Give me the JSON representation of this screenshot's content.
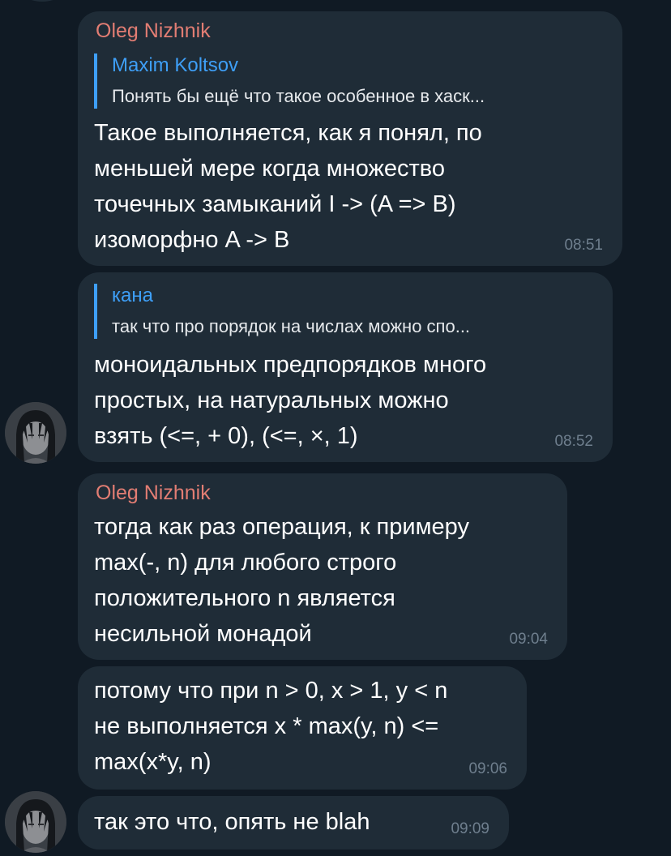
{
  "messages": [
    {
      "author": "Oleg Nizhnik",
      "reply": {
        "name": "Maxim Koltsov",
        "text": "Понять бы ещё что такое особенное в хаск..."
      },
      "text": "Такое выполняется, как я понял, по\nменьшей мере когда множество\nточечных замыканий I -> (A => B)\nизоморфно A -> B",
      "time": "08:51"
    },
    {
      "reply": {
        "name": "кана",
        "text": "так что про порядок на числах можно спо..."
      },
      "text": "моноидальных предпорядков много\nпростых, на натуральных можно\nвзять (<=, + 0), (<=, ×, 1)",
      "time": "08:52"
    },
    {
      "author": "Oleg Nizhnik",
      "text": "тогда как раз операция, к примеру\nmax(-, n) для любого строго\nположительного n является\nнесильной монадой",
      "time": "09:04"
    },
    {
      "text": "потому что при n > 0, x > 1, y < n\nне выполняется x * max(y, n) <=\nmax(x*y, n)",
      "time": "09:06"
    },
    {
      "text": "так это что, опять не blah",
      "time": "09:09"
    }
  ],
  "colors": {
    "background": "#101a24",
    "bubble": "#1f2c37",
    "author": "#e27d73",
    "reply_accent": "#3e9ff7",
    "timestamp": "#6f7f8e"
  },
  "icons": {
    "avatar": "user-avatar-portrait"
  }
}
